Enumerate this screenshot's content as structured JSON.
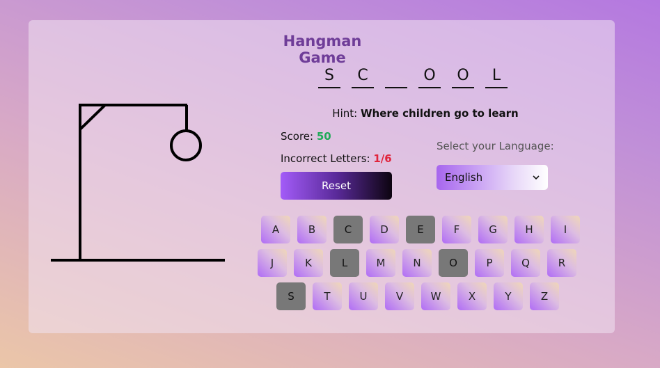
{
  "title": "Hangman Game",
  "word": [
    "S",
    "C",
    "",
    "O",
    "O",
    "L"
  ],
  "hint": {
    "label": "Hint:",
    "text": "Where children go to learn"
  },
  "score": {
    "label": "Score:",
    "value": "50"
  },
  "incorrect": {
    "label": "Incorrect Letters:",
    "value": "1/6"
  },
  "reset_label": "Reset",
  "language": {
    "label": "Select your Language:",
    "selected": "English"
  },
  "keyboard": {
    "rows": [
      [
        "A",
        "B",
        "C",
        "D",
        "E",
        "F",
        "G",
        "H",
        "I"
      ],
      [
        "J",
        "K",
        "L",
        "M",
        "N",
        "O",
        "P",
        "Q",
        "R"
      ],
      [
        "S",
        "T",
        "U",
        "V",
        "W",
        "X",
        "Y",
        "Z"
      ]
    ],
    "used": [
      "C",
      "E",
      "L",
      "O",
      "S"
    ]
  }
}
